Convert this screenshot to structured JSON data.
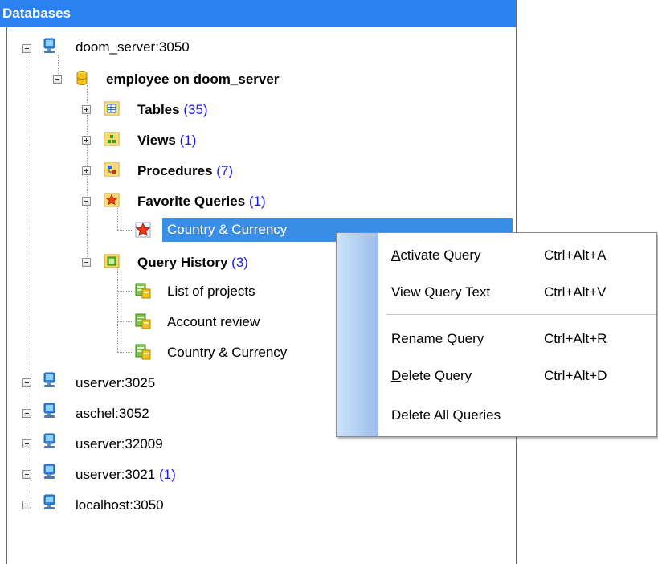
{
  "panel": {
    "title": "Databases"
  },
  "tree": {
    "server_doom": {
      "label": "doom_server:3050"
    },
    "database": {
      "label": "employee on doom_server"
    },
    "tables": {
      "label": "Tables",
      "count": "(35)"
    },
    "views": {
      "label": "Views",
      "count": "(1)"
    },
    "procedures": {
      "label": "Procedures",
      "count": "(7)"
    },
    "favorite_queries": {
      "label": "Favorite Queries",
      "count": "(1)"
    },
    "favorite_items": [
      {
        "label": "Country & Currency"
      }
    ],
    "query_history": {
      "label": "Query History",
      "count": "(3)"
    },
    "history_items": [
      {
        "label": "List of projects"
      },
      {
        "label": "Account review"
      },
      {
        "label": "Country & Currency"
      }
    ],
    "other_servers": [
      {
        "label": "userver:3025",
        "count": ""
      },
      {
        "label": "aschel:3052",
        "count": ""
      },
      {
        "label": "userver:32009",
        "count": ""
      },
      {
        "label": "userver:3021",
        "count": "(1)"
      },
      {
        "label": "localhost:3050",
        "count": ""
      }
    ]
  },
  "context_menu": {
    "items": [
      {
        "label_first": "A",
        "label_rest": "ctivate Query",
        "shortcut": "Ctrl+Alt+A"
      },
      {
        "label": "View Query Text",
        "shortcut": "Ctrl+Alt+V"
      },
      {
        "label": "Rename Query",
        "shortcut": "Ctrl+Alt+R"
      },
      {
        "label_first": "D",
        "label_rest": "elete Query",
        "shortcut": "Ctrl+Alt+D"
      },
      {
        "label": "Delete All Queries",
        "shortcut": ""
      }
    ]
  },
  "colors": {
    "header_bg": "#2b81ef",
    "selection_bg": "#3a8ee6",
    "count_text": "#1a1aff"
  },
  "icons": {
    "server": "server-icon",
    "database": "database-icon",
    "tables": "tables-icon",
    "views": "views-icon",
    "procedures": "procedures-icon",
    "favorites": "favorite-star-icon",
    "history": "query-history-icon"
  }
}
